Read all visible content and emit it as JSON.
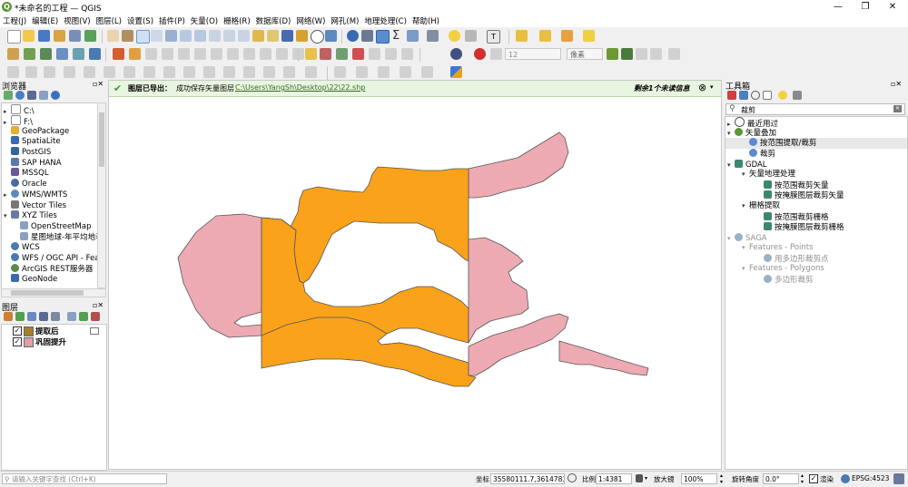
{
  "window": {
    "title": "*未命名的工程 — QGIS"
  },
  "menu": [
    "工程(J)",
    "编辑(E)",
    "视图(V)",
    "图层(L)",
    "设置(S)",
    "插件(P)",
    "矢量(O)",
    "栅格(R)",
    "数据库(D)",
    "网络(W)",
    "网孔(M)",
    "地理处理(C)",
    "帮助(H)"
  ],
  "toolbar": {
    "crs_combo": "像素",
    "size_value": "12"
  },
  "browser": {
    "title": "浏览器",
    "items": [
      {
        "label": "C:\\",
        "icon": "folder-icon",
        "expandable": true
      },
      {
        "label": "F:\\",
        "icon": "folder-icon",
        "expandable": true
      },
      {
        "label": "GeoPackage",
        "icon": "geopackage-icon",
        "expandable": false
      },
      {
        "label": "SpatiaLite",
        "icon": "spatialite-icon",
        "expandable": false
      },
      {
        "label": "PostGIS",
        "icon": "postgis-icon",
        "expandable": false
      },
      {
        "label": "SAP HANA",
        "icon": "hana-icon",
        "expandable": false
      },
      {
        "label": "MSSQL",
        "icon": "mssql-icon",
        "expandable": false
      },
      {
        "label": "Oracle",
        "icon": "oracle-icon",
        "expandable": false
      },
      {
        "label": "WMS/WMTS",
        "icon": "wms-icon",
        "expandable": true
      },
      {
        "label": "Vector Tiles",
        "icon": "vector-tiles-icon",
        "expandable": false
      },
      {
        "label": "XYZ Tiles",
        "icon": "xyz-icon",
        "expandable": true,
        "expanded": true
      },
      {
        "label": "OpenStreetMap",
        "icon": "grid-icon",
        "child": true
      },
      {
        "label": "星图地球-年平均地表",
        "icon": "grid-icon",
        "child": true
      },
      {
        "label": "WCS",
        "icon": "wcs-icon",
        "expandable": false
      },
      {
        "label": "WFS / OGC API - Feat",
        "icon": "wfs-icon",
        "expandable": false
      },
      {
        "label": "ArcGIS REST服务器",
        "icon": "arcgis-icon",
        "expandable": false
      },
      {
        "label": "GeoNode",
        "icon": "geonode-icon",
        "expandable": false
      }
    ]
  },
  "layers": {
    "title": "图层",
    "items": [
      {
        "label": "提取后",
        "checked": true,
        "color": "#a57e2e"
      },
      {
        "label": "巩固提升",
        "checked": true,
        "color": "#e0a0a8"
      }
    ]
  },
  "message": {
    "prefix": "图层已导出：",
    "text": "成功保存矢量图层",
    "path": "C:\\Users\\YangSh\\Desktop\\22\\22.shp",
    "unread": "剩余1个未读信息"
  },
  "toolbox": {
    "title": "工具箱",
    "search_placeholder": "裁剪",
    "items": [
      {
        "label": "最近用过",
        "level": 0,
        "arrow": "▸",
        "icon": "clock-icon"
      },
      {
        "label": "矢量叠加",
        "level": 0,
        "arrow": "▾",
        "icon": "qgis-icon"
      },
      {
        "label": "按范围提取/裁剪",
        "level": 1,
        "icon": "gear-icon",
        "selected": true
      },
      {
        "label": "裁剪",
        "level": 1,
        "icon": "gear-icon"
      },
      {
        "label": "GDAL",
        "level": 0,
        "arrow": "▾",
        "icon": "gdal-icon"
      },
      {
        "label": "矢量地理处理",
        "level": 1,
        "arrow": "▾"
      },
      {
        "label": "按范围裁剪矢量",
        "level": 2,
        "icon": "gdal-icon"
      },
      {
        "label": "按掩膜图层裁剪矢量",
        "level": 2,
        "icon": "gdal-icon"
      },
      {
        "label": "栅格提取",
        "level": 1,
        "arrow": "▾"
      },
      {
        "label": "按范围裁剪栅格",
        "level": 2,
        "icon": "gdal-icon"
      },
      {
        "label": "按掩膜图层裁剪栅格",
        "level": 2,
        "icon": "gdal-icon"
      },
      {
        "label": "SAGA",
        "level": 0,
        "arrow": "▾",
        "icon": "saga-icon",
        "disabled": true
      },
      {
        "label": "Features - Points",
        "level": 1,
        "arrow": "▾",
        "disabled": true
      },
      {
        "label": "用多边形裁剪点",
        "level": 2,
        "icon": "saga-icon",
        "disabled": true
      },
      {
        "label": "Features - Polygons",
        "level": 1,
        "arrow": "▾",
        "disabled": true
      },
      {
        "label": "多边形裁剪",
        "level": 2,
        "icon": "saga-icon",
        "disabled": true
      }
    ]
  },
  "status": {
    "locator_placeholder": "请输入关键字查找 (Ctrl+K)",
    "coord_label": "坐标",
    "coord_value": "35580111.7,3614783.8",
    "scale_label": "比例",
    "scale_value": "1:4381",
    "magnifier_label": "放大镜",
    "magnifier_value": "100%",
    "rotation_label": "旋转角度",
    "rotation_value": "0.0°",
    "render_label": "渲染",
    "crs": "EPSG:4523"
  },
  "colors": {
    "orange": "#f9a21a",
    "pink": "#eeaab3",
    "outline": "#555555",
    "msgbg": "#e8f5e0"
  }
}
